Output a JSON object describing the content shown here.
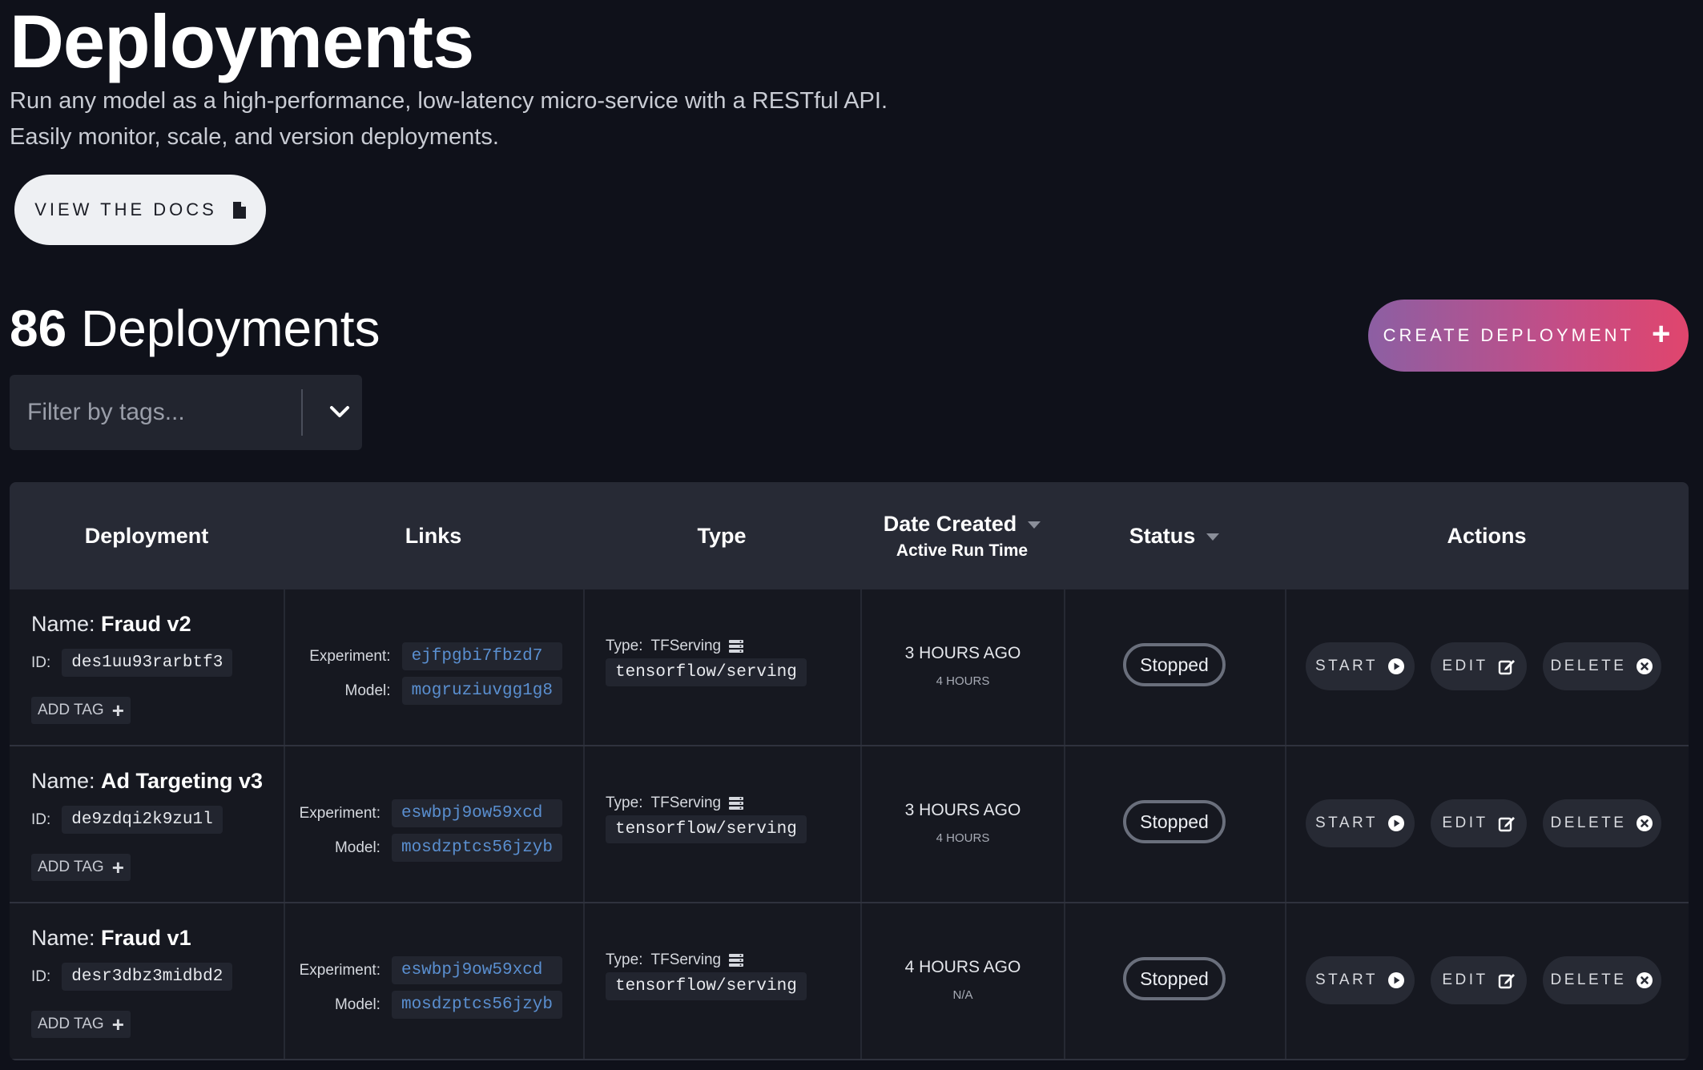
{
  "header": {
    "title": "Deployments",
    "subtitle_line1": "Run any model as a high-performance, low-latency micro-service with a RESTful API.",
    "subtitle_line2": "Easily monitor, scale, and version deployments.",
    "docs_button_label": "VIEW THE DOCS"
  },
  "summary": {
    "count": "86",
    "count_label": "Deployments",
    "create_button_label": "CREATE DEPLOYMENT"
  },
  "filter": {
    "placeholder": "Filter by tags..."
  },
  "table": {
    "columns": {
      "deployment": "Deployment",
      "links": "Links",
      "type": "Type",
      "date_created": "Date Created",
      "active_run_time": "Active Run Time",
      "status": "Status",
      "actions": "Actions"
    },
    "labels": {
      "name": "Name:",
      "id": "ID:",
      "add_tag": "ADD TAG",
      "experiment": "Experiment:",
      "model": "Model:",
      "type": "Type:",
      "start": "START",
      "edit": "EDIT",
      "delete": "DELETE"
    },
    "rows": [
      {
        "name": "Fraud v2",
        "id": "des1uu93rarbtf3",
        "experiment": "ejfpgbi7fbzd7",
        "model": "mogruziuvgg1g8",
        "type": "TFServing",
        "image": "tensorflow/serving",
        "date_created": "3 HOURS AGO",
        "active_run_time": "4 HOURS",
        "status": "Stopped"
      },
      {
        "name": "Ad Targeting v3",
        "id": "de9zdqi2k9zu1l",
        "experiment": "eswbpj9ow59xcd",
        "model": "mosdzptcs56jzyb",
        "type": "TFServing",
        "image": "tensorflow/serving",
        "date_created": "3 HOURS AGO",
        "active_run_time": "4 HOURS",
        "status": "Stopped"
      },
      {
        "name": "Fraud v1",
        "id": "desr3dbz3midbd2",
        "experiment": "eswbpj9ow59xcd",
        "model": "mosdzptcs56jzyb",
        "type": "TFServing",
        "image": "tensorflow/serving",
        "date_created": "4 HOURS AGO",
        "active_run_time": "N/A",
        "status": "Stopped"
      }
    ]
  },
  "colors": {
    "background": "#0f111a",
    "link": "#5a8fd0",
    "gradient_start": "#8c5fa3",
    "gradient_end": "#e0456d"
  },
  "icons": {
    "docs": "file-icon",
    "create": "plus-icon",
    "filter": "chevron-down-icon",
    "add_tag": "plus-icon",
    "type": "server-icon",
    "start": "play-circle-icon",
    "edit": "edit-icon",
    "delete": "close-circle-icon",
    "sort": "caret-down-icon"
  }
}
